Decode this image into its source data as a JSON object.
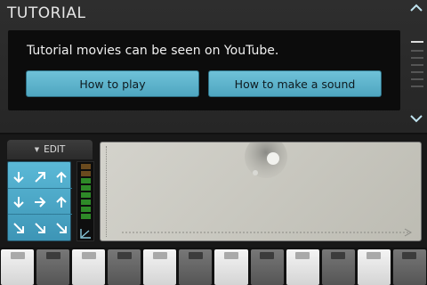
{
  "header": {
    "title": "TUTORIAL"
  },
  "info": {
    "text": "Tutorial movies can be seen on YouTube.",
    "buttons": {
      "how_to_play": "How to play",
      "how_to_make_sound": "How to make a sound"
    }
  },
  "edit_tab": {
    "label": "EDIT",
    "caret_icon": "triangle-down-icon"
  },
  "arrow_pad": {
    "rows": [
      [
        "arrow-down-icon",
        "arrow-up-right-icon",
        "arrow-up-icon"
      ],
      [
        "arrow-down-icon",
        "arrow-right-icon",
        "arrow-up-icon"
      ],
      [
        "arrow-down-right-icon",
        "arrow-down-right-icon",
        "arrow-down-right-icon"
      ]
    ]
  },
  "colors": {
    "accent": "#5bb9d7",
    "panel_bg": "#0c0c0c",
    "meter_green": "#2e8a28"
  },
  "keyboard": {
    "keys": [
      "light",
      "dark",
      "light",
      "dark",
      "light",
      "dark",
      "light",
      "dark",
      "light",
      "dark",
      "light",
      "dark"
    ]
  }
}
